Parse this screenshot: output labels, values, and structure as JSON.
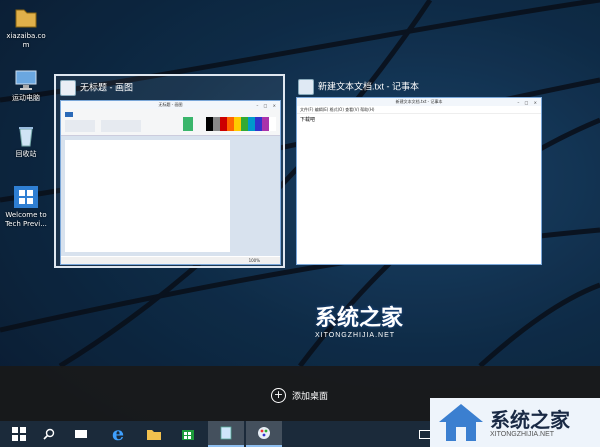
{
  "desktop": {
    "icons": [
      {
        "label": "xiazaiba.co m"
      },
      {
        "label": "运动电脑"
      },
      {
        "label": "回收站"
      },
      {
        "label": "Welcome to Tech Previ..."
      }
    ]
  },
  "task_view": {
    "windows": [
      {
        "title": "无标题 - 画图",
        "inner_title": "无标题 - 画图",
        "status": "100%"
      },
      {
        "title": "新建文本文档.txt - 记事本",
        "inner_title": "新建文本文档.txt - 记事本",
        "menu": "文件(F)  编辑(E)  格式(O)  查看(V)  帮助(H)",
        "content": "下载吧"
      }
    ],
    "add_desktop_label": "添加桌面"
  },
  "watermark": {
    "brand": "系统之家",
    "url": "XITONGZHIJIA.NET"
  },
  "corner_logo": {
    "brand": "系统之家",
    "url": "XITONGZHIJIA.NET"
  },
  "taskbar": {
    "items": [
      "start-icon",
      "search-icon",
      "task-view-icon",
      "ie-icon",
      "file-explorer-icon",
      "store-icon",
      "notepad-icon",
      "paint-icon"
    ]
  },
  "colors": {
    "accent": "#8fbff0",
    "taskbar_bg": "#1b2a3a",
    "bottom_bar_bg": "#191919"
  }
}
